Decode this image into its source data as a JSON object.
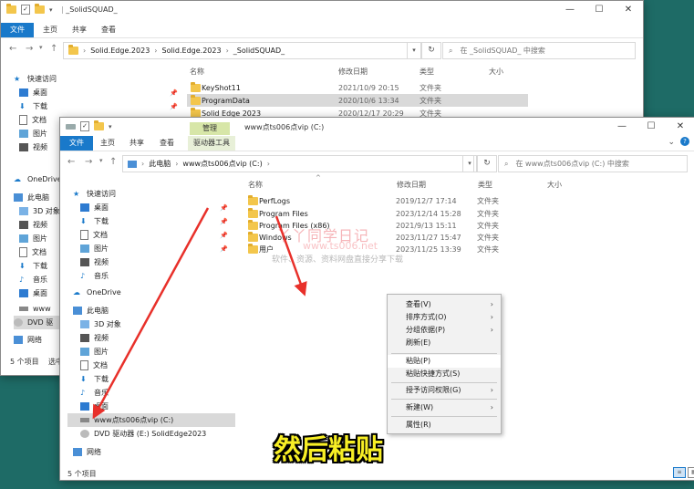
{
  "back_window": {
    "title": "_SolidSQUAD_",
    "ribbon_tabs": [
      "文件",
      "主页",
      "共享",
      "查看"
    ],
    "breadcrumb": [
      "Solid.Edge.2023",
      "Solid.Edge.2023",
      "_SolidSQUAD_"
    ],
    "search_placeholder": "在 _SolidSQUAD_ 中搜索",
    "columns": {
      "name": "名称",
      "date": "修改日期",
      "type": "类型",
      "size": "大小"
    },
    "files": [
      {
        "name": "KeyShot11",
        "date": "2021/10/9 20:15",
        "type": "文件夹"
      },
      {
        "name": "ProgramData",
        "date": "2020/10/6 13:34",
        "type": "文件夹"
      },
      {
        "name": "Solid Edge 2023",
        "date": "2020/12/17 20:29",
        "type": "文件夹"
      }
    ],
    "nav": [
      {
        "label": "快速访问",
        "icon": "star-icon"
      },
      {
        "label": "桌面",
        "icon": "desktop-icon"
      },
      {
        "label": "下载",
        "icon": "download-icon"
      },
      {
        "label": "文档",
        "icon": "document-icon"
      },
      {
        "label": "图片",
        "icon": "picture-icon"
      },
      {
        "label": "视频",
        "icon": "video-icon"
      },
      {
        "label": "OneDrive",
        "icon": "cloud-icon"
      },
      {
        "label": "此电脑",
        "icon": "computer-icon"
      },
      {
        "label": "3D 对象",
        "icon": "3d-objects-icon"
      },
      {
        "label": "视频",
        "icon": "video-icon"
      },
      {
        "label": "图片",
        "icon": "picture-icon"
      },
      {
        "label": "文档",
        "icon": "document-icon"
      },
      {
        "label": "下载",
        "icon": "download-icon"
      },
      {
        "label": "音乐",
        "icon": "music-icon"
      },
      {
        "label": "桌面",
        "icon": "desktop-icon"
      },
      {
        "label": "www",
        "icon": "drive-icon"
      },
      {
        "label": "DVD 驱",
        "icon": "dvd-icon"
      },
      {
        "label": "网络",
        "icon": "network-icon"
      }
    ],
    "status_count": "5 个项目",
    "status_selected": "选中"
  },
  "front_window": {
    "title": "www点ts006点vip (C:)",
    "manage_tab": "管理",
    "ribbon_tabs": [
      "文件",
      "主页",
      "共享",
      "查看"
    ],
    "drive_tools_tab": "驱动器工具",
    "breadcrumb": [
      "此电脑",
      "www点ts006点vip (C:)"
    ],
    "search_placeholder": "在 www点ts006点vip (C:) 中搜索",
    "columns": {
      "name": "名称",
      "date": "修改日期",
      "type": "类型",
      "size": "大小"
    },
    "files": [
      {
        "name": "PerfLogs",
        "date": "2019/12/7 17:14",
        "type": "文件夹"
      },
      {
        "name": "Program Files",
        "date": "2023/12/14 15:28",
        "type": "文件夹"
      },
      {
        "name": "Program Files (x86)",
        "date": "2021/9/13 15:11",
        "type": "文件夹"
      },
      {
        "name": "Windows",
        "date": "2023/11/27 15:47",
        "type": "文件夹"
      },
      {
        "name": "用户",
        "date": "2023/11/25 13:39",
        "type": "文件夹"
      }
    ],
    "nav": [
      {
        "label": "快速访问",
        "icon": "star-icon",
        "pinned": false,
        "selected": false
      },
      {
        "label": "桌面",
        "icon": "desktop-icon",
        "pinned": true,
        "selected": false
      },
      {
        "label": "下载",
        "icon": "download-icon",
        "pinned": true,
        "selected": false
      },
      {
        "label": "文档",
        "icon": "document-icon",
        "pinned": true,
        "selected": false
      },
      {
        "label": "图片",
        "icon": "picture-icon",
        "pinned": true,
        "selected": false
      },
      {
        "label": "视频",
        "icon": "video-icon",
        "pinned": false,
        "selected": false
      },
      {
        "label": "音乐",
        "icon": "music-icon",
        "pinned": false,
        "selected": false
      },
      {
        "label": "",
        "icon": "",
        "pinned": false,
        "selected": false
      },
      {
        "label": "OneDrive",
        "icon": "cloud-icon",
        "pinned": false,
        "selected": false
      },
      {
        "label": "",
        "icon": "",
        "pinned": false,
        "selected": false
      },
      {
        "label": "此电脑",
        "icon": "computer-icon",
        "pinned": false,
        "selected": false
      },
      {
        "label": "3D 对象",
        "icon": "3d-objects-icon",
        "pinned": false,
        "selected": false
      },
      {
        "label": "视频",
        "icon": "video-icon",
        "pinned": false,
        "selected": false
      },
      {
        "label": "图片",
        "icon": "picture-icon",
        "pinned": false,
        "selected": false
      },
      {
        "label": "文档",
        "icon": "document-icon",
        "pinned": false,
        "selected": false
      },
      {
        "label": "下载",
        "icon": "download-icon",
        "pinned": false,
        "selected": false
      },
      {
        "label": "音乐",
        "icon": "music-icon",
        "pinned": false,
        "selected": false
      },
      {
        "label": "桌面",
        "icon": "desktop-icon",
        "pinned": false,
        "selected": false
      },
      {
        "label": "www点ts006点vip (C:)",
        "icon": "drive-icon",
        "pinned": false,
        "selected": true
      },
      {
        "label": "DVD 驱动器 (E:) SolidEdge2023",
        "icon": "dvd-icon",
        "pinned": false,
        "selected": false
      },
      {
        "label": "",
        "icon": "",
        "pinned": false,
        "selected": false
      },
      {
        "label": "网络",
        "icon": "network-icon",
        "pinned": false,
        "selected": false
      }
    ],
    "status_count": "5 个项目"
  },
  "context_menu": [
    {
      "label": "查看(V)",
      "submenu": true
    },
    {
      "label": "排序方式(O)",
      "submenu": true
    },
    {
      "label": "分组依据(P)",
      "submenu": true
    },
    {
      "label": "刷新(E)",
      "submenu": false
    },
    {
      "separator": true
    },
    {
      "label": "粘贴(P)",
      "submenu": false,
      "highlight": true
    },
    {
      "label": "粘贴快捷方式(S)",
      "submenu": false
    },
    {
      "separator": true
    },
    {
      "label": "授予访问权限(G)",
      "submenu": true
    },
    {
      "separator": true
    },
    {
      "label": "新建(W)",
      "submenu": true
    },
    {
      "separator": true
    },
    {
      "label": "属性(R)",
      "submenu": false
    }
  ],
  "watermark": {
    "line1": "丫丫同学日记",
    "line2": "www.ts006.net",
    "line3": "软件、资源、资料网盘直接分享下载"
  },
  "caption": "然后粘贴",
  "colors": {
    "accent": "#1979ca",
    "folder": "#f3c64c",
    "desktop_bg": "#1e6b66",
    "arrow": "#e8302a",
    "caption": "#f7ee25"
  }
}
